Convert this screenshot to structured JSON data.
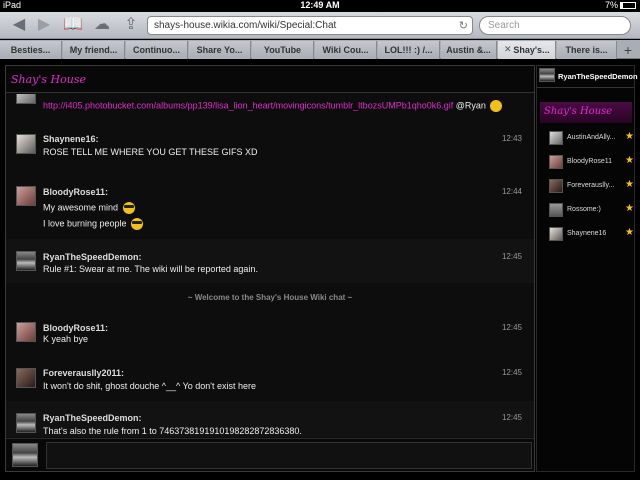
{
  "status": {
    "device": "iPad",
    "time": "12:49 AM",
    "battery": "7%"
  },
  "toolbar": {
    "url": "shays-house.wikia.com/wiki/Special:Chat",
    "search_placeholder": "Search"
  },
  "tabs": [
    {
      "label": "Besties..."
    },
    {
      "label": "My friend..."
    },
    {
      "label": "Continuo..."
    },
    {
      "label": "Share Yo..."
    },
    {
      "label": "YouTube"
    },
    {
      "label": "Wiki Cou..."
    },
    {
      "label": "LOL!!! :) /..."
    },
    {
      "label": "Austin &..."
    },
    {
      "label": "Shay's..."
    },
    {
      "label": "There is..."
    }
  ],
  "chat": {
    "wiki_name": "Shay's House",
    "first": {
      "link": "http://i405.photobucket.com/albums/pp139/lisa_lion_heart/movingicons/tumblr_ltbozsUMPb1qho0k6.gif",
      "mention": "@Ryan"
    },
    "messages": [
      {
        "user": "Shaynene16:",
        "time": "12:43",
        "lines": [
          "ROSE TELL ME WHERE YOU GET THESE GIFS XD"
        ]
      },
      {
        "user": "BloodyRose11:",
        "time": "12:44",
        "lines": [
          "My awesome mind",
          "I love burning people"
        ]
      },
      {
        "user": "RyanTheSpeedDemon:",
        "time": "12:45",
        "lines": [
          "Rule #1: Swear at me. The wiki will be reported again."
        ]
      },
      {
        "user": "BloodyRose11:",
        "time": "12:45",
        "lines": [
          "K yeah bye"
        ]
      },
      {
        "user": "Foreverauslly2011:",
        "time": "12:45",
        "lines": [
          "It won't do shit, ghost douche ^__^ Yo don't exist here"
        ]
      },
      {
        "user": "RyanTheSpeedDemon:",
        "time": "12:45",
        "lines": [
          "That's also the rule from 1 to 7463738191910198282872836380."
        ]
      }
    ],
    "welcome": "~ Welcome to the Shay's House Wiki chat ~"
  },
  "rail": {
    "current_user": "RyanTheSpeedDemon",
    "wiki_name": "Shay's House",
    "users": [
      "AustinAndAlly...",
      "BloodyRose11",
      "Foreverauslly...",
      "Rossome:)",
      "Shaynene16"
    ]
  },
  "colors": {
    "accent": "#e02ccd",
    "star": "#f3c01b"
  }
}
